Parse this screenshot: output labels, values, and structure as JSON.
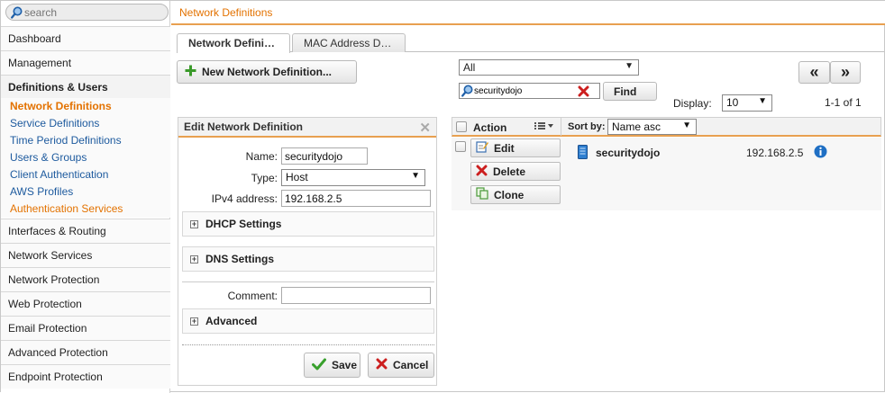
{
  "sidebar": {
    "search_placeholder": "search",
    "items": [
      {
        "label": "Dashboard"
      },
      {
        "label": "Management"
      },
      {
        "label": "Definitions & Users"
      },
      {
        "label": "Interfaces & Routing"
      },
      {
        "label": "Network Services"
      },
      {
        "label": "Network Protection"
      },
      {
        "label": "Web Protection"
      },
      {
        "label": "Email Protection"
      },
      {
        "label": "Advanced Protection"
      },
      {
        "label": "Endpoint Protection"
      }
    ],
    "subitems": [
      {
        "label": "Network Definitions"
      },
      {
        "label": "Service Definitions"
      },
      {
        "label": "Time Period Definitions"
      },
      {
        "label": "Users & Groups"
      },
      {
        "label": "Client Authentication"
      },
      {
        "label": "AWS Profiles"
      },
      {
        "label": "Authentication Services"
      }
    ]
  },
  "header": {
    "title": "Network Definitions"
  },
  "tabs": [
    {
      "label": "Network Defini…"
    },
    {
      "label": "MAC Address D…"
    }
  ],
  "toolbar": {
    "new_label": "New Network Definition..."
  },
  "edit": {
    "title": "Edit Network Definition",
    "name_label": "Name:",
    "name_value": "securitydojo",
    "type_label": "Type:",
    "type_value": "Host",
    "ipv4_label": "IPv4 address:",
    "ipv4_value": "192.168.2.5",
    "dhcp_label": "DHCP Settings",
    "dns_label": "DNS Settings",
    "comment_label": "Comment:",
    "comment_value": "",
    "advanced_label": "Advanced",
    "save_label": "Save",
    "cancel_label": "Cancel"
  },
  "filter": {
    "scope_value": "All",
    "search_value": "securitydojo",
    "find_label": "Find",
    "display_label": "Display:",
    "display_value": "10",
    "range_text": "1-1 of 1",
    "prev_label": "«",
    "next_label": "»"
  },
  "results": {
    "action_label": "Action",
    "sortby_label": "Sort by:",
    "sort_value": "Name asc",
    "rows": [
      {
        "name": "securitydojo",
        "ip": "192.168.2.5",
        "edit_label": "Edit",
        "delete_label": "Delete",
        "clone_label": "Clone"
      }
    ]
  },
  "colors": {
    "accent": "#e37200",
    "link": "#1d5a9e"
  }
}
